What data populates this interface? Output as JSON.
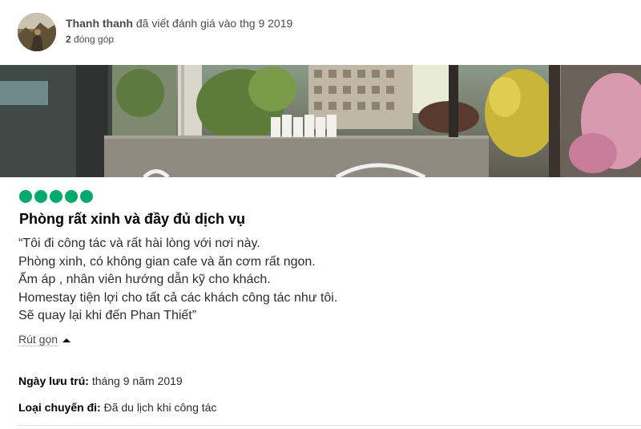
{
  "review": {
    "author": {
      "name": "Thanh thanh",
      "action": "đã viết đánh giá vào thg 9 2019",
      "contributions_count": "2",
      "contributions_label": "đóng góp"
    },
    "rating_bubbles": 5,
    "rating_color": "#00aa6c",
    "title": "Phòng rất xinh và đầy đủ dịch vụ",
    "body_lines": [
      "“Tôi đi công tác và rất hài lòng với nơi này.",
      "Phòng xinh, có không gian cafe và ăn cơm rất ngon.",
      "Ấm áp , nhân viên hướng dẫn kỹ cho khách.",
      "Homestay tiện lợi cho tất cả các khách công tác như tôi.",
      "Sẽ quay lại khi đến Phan Thiết”"
    ],
    "collapse_label": "Rút gọn",
    "stay": {
      "label": "Ngày lưu trú:",
      "value": "tháng 9 năm 2019"
    },
    "trip_type": {
      "label": "Loại chuyến đi:",
      "value": "Đã du lịch khi công tác"
    }
  }
}
